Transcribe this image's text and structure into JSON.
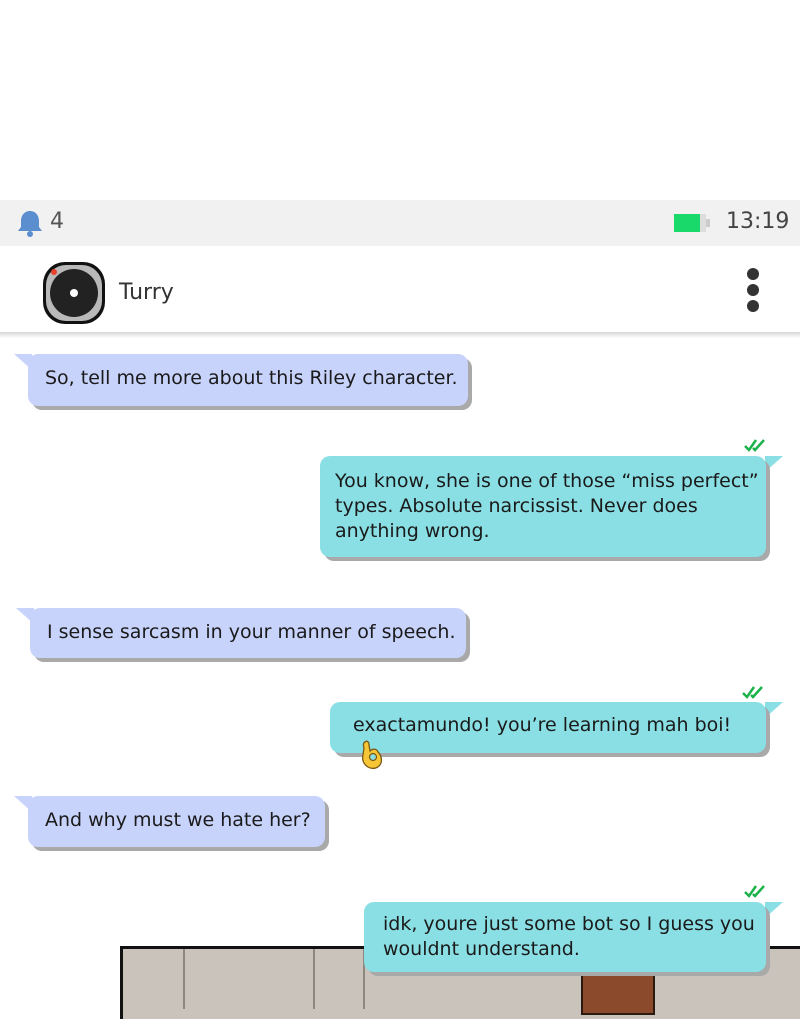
{
  "status_bar": {
    "notification_count": "4",
    "time": "13:19",
    "battery_color": "#19d96a"
  },
  "chat_header": {
    "contact_name": "Turry",
    "avatar_icon": "camera-lens-icon",
    "menu_icon": "more-vertical-icon"
  },
  "messages": [
    {
      "direction": "incoming",
      "text": "So, tell me more about this Riley character."
    },
    {
      "direction": "outgoing",
      "read": true,
      "lines": [
        "You know, she is one of those “miss perfect”",
        "types. Absolute narcissist. Never does",
        "anything wrong."
      ]
    },
    {
      "direction": "incoming",
      "text": "I sense sarcasm in your manner of speech."
    },
    {
      "direction": "outgoing",
      "read": true,
      "text": "exactamundo! you’re learning mah boi!",
      "emoji": "ok-hand-emoji"
    },
    {
      "direction": "incoming",
      "text": "And why must we hate her?"
    },
    {
      "direction": "outgoing",
      "read": true,
      "lines": [
        "idk, youre just some bot so I guess you",
        "wouldnt understand."
      ]
    }
  ],
  "colors": {
    "incoming_bubble": "#c8d3fb",
    "outgoing_bubble": "#8adfe4",
    "read_check": "#1bb24a"
  }
}
